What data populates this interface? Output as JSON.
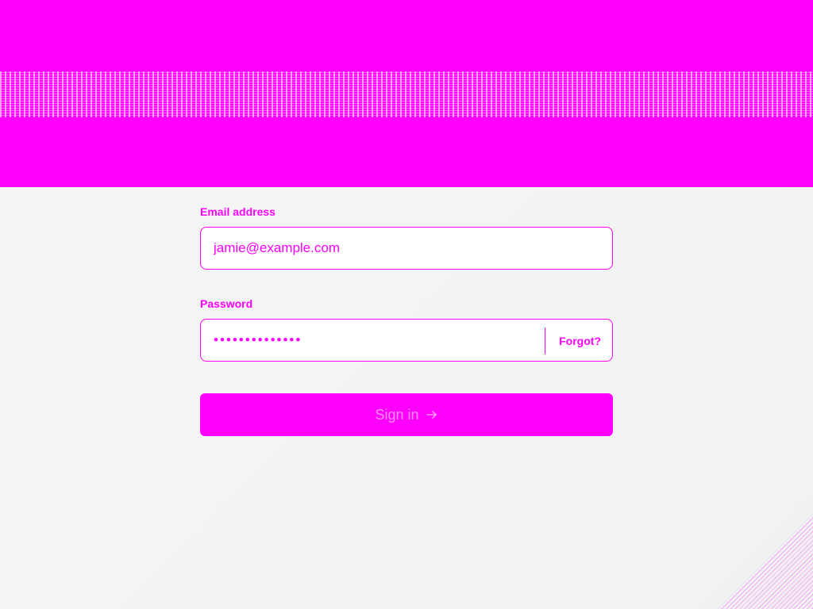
{
  "form": {
    "email_label": "Email address",
    "email_value": "jamie@example.com",
    "password_label": "Password",
    "password_value": "••••••••••••••",
    "forgot_label": "Forgot?",
    "signin_label": "Sign in",
    "signin_icon": "arrow-right-icon"
  },
  "colors": {
    "accent": "#ff00ff",
    "background": "#f4f4f4"
  }
}
